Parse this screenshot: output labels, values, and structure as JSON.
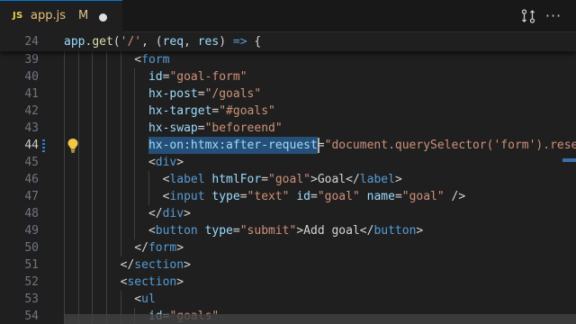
{
  "tab": {
    "icon_text": "JS",
    "file_name": "app.js",
    "modified_flag": "M"
  },
  "actions": {
    "more_label": "···"
  },
  "sticky_line": {
    "number": "24",
    "tokens": [
      {
        "t": "app",
        "c": "var"
      },
      {
        "t": ".",
        "c": "punc"
      },
      {
        "t": "get",
        "c": "fn"
      },
      {
        "t": "(",
        "c": "punc"
      },
      {
        "t": "'/'",
        "c": "str"
      },
      {
        "t": ", (",
        "c": "punc"
      },
      {
        "t": "req",
        "c": "var"
      },
      {
        "t": ", ",
        "c": "punc"
      },
      {
        "t": "res",
        "c": "var"
      },
      {
        "t": ") ",
        "c": "punc"
      },
      {
        "t": "=>",
        "c": "kw"
      },
      {
        "t": " {",
        "c": "punc"
      }
    ]
  },
  "lines": [
    {
      "number": "39",
      "indent": 5,
      "tokens": [
        {
          "t": "<",
          "c": "punc"
        },
        {
          "t": "form",
          "c": "tag"
        }
      ]
    },
    {
      "number": "40",
      "indent": 6,
      "tokens": [
        {
          "t": "id",
          "c": "attr"
        },
        {
          "t": "=",
          "c": "punc"
        },
        {
          "t": "\"goal-form\"",
          "c": "str"
        }
      ]
    },
    {
      "number": "41",
      "indent": 6,
      "tokens": [
        {
          "t": "hx-post",
          "c": "attr"
        },
        {
          "t": "=",
          "c": "punc"
        },
        {
          "t": "\"/goals\"",
          "c": "str"
        }
      ]
    },
    {
      "number": "42",
      "indent": 6,
      "tokens": [
        {
          "t": "hx-target",
          "c": "attr"
        },
        {
          "t": "=",
          "c": "punc"
        },
        {
          "t": "\"#goals\"",
          "c": "str"
        }
      ]
    },
    {
      "number": "43",
      "indent": 6,
      "tokens": [
        {
          "t": "hx-swap",
          "c": "attr"
        },
        {
          "t": "=",
          "c": "punc"
        },
        {
          "t": "\"beforeend\"",
          "c": "str"
        }
      ]
    },
    {
      "number": "44",
      "indent": 6,
      "active": true,
      "selection": [
        0,
        23
      ],
      "tokens": [
        {
          "t": "hx-on:htmx:after-request",
          "c": "attr"
        },
        {
          "t": "=",
          "c": "punc"
        },
        {
          "t": "\"document.querySelector('form').reset()\"",
          "c": "str"
        }
      ]
    },
    {
      "number": "45",
      "indent": 6,
      "tokens": [
        {
          "t": "<",
          "c": "punc"
        },
        {
          "t": "div",
          "c": "tag"
        },
        {
          "t": ">",
          "c": "punc"
        }
      ]
    },
    {
      "number": "46",
      "indent": 7,
      "tokens": [
        {
          "t": "<",
          "c": "punc"
        },
        {
          "t": "label",
          "c": "tag"
        },
        {
          "t": " ",
          "c": "text"
        },
        {
          "t": "htmlFor",
          "c": "attr"
        },
        {
          "t": "=",
          "c": "punc"
        },
        {
          "t": "\"goal\"",
          "c": "str"
        },
        {
          "t": ">",
          "c": "punc"
        },
        {
          "t": "Goal",
          "c": "text"
        },
        {
          "t": "</",
          "c": "punc"
        },
        {
          "t": "label",
          "c": "tag"
        },
        {
          "t": ">",
          "c": "punc"
        }
      ]
    },
    {
      "number": "47",
      "indent": 7,
      "tokens": [
        {
          "t": "<",
          "c": "punc"
        },
        {
          "t": "input",
          "c": "tag"
        },
        {
          "t": " ",
          "c": "text"
        },
        {
          "t": "type",
          "c": "attr"
        },
        {
          "t": "=",
          "c": "punc"
        },
        {
          "t": "\"text\"",
          "c": "str"
        },
        {
          "t": " ",
          "c": "text"
        },
        {
          "t": "id",
          "c": "attr"
        },
        {
          "t": "=",
          "c": "punc"
        },
        {
          "t": "\"goal\"",
          "c": "str"
        },
        {
          "t": " ",
          "c": "text"
        },
        {
          "t": "name",
          "c": "attr"
        },
        {
          "t": "=",
          "c": "punc"
        },
        {
          "t": "\"goal\"",
          "c": "str"
        },
        {
          "t": " />",
          "c": "punc"
        }
      ]
    },
    {
      "number": "48",
      "indent": 6,
      "tokens": [
        {
          "t": "</",
          "c": "punc"
        },
        {
          "t": "div",
          "c": "tag"
        },
        {
          "t": ">",
          "c": "punc"
        }
      ]
    },
    {
      "number": "49",
      "indent": 6,
      "tokens": [
        {
          "t": "<",
          "c": "punc"
        },
        {
          "t": "button",
          "c": "tag"
        },
        {
          "t": " ",
          "c": "text"
        },
        {
          "t": "type",
          "c": "attr"
        },
        {
          "t": "=",
          "c": "punc"
        },
        {
          "t": "\"submit\"",
          "c": "str"
        },
        {
          "t": ">",
          "c": "punc"
        },
        {
          "t": "Add goal",
          "c": "text"
        },
        {
          "t": "</",
          "c": "punc"
        },
        {
          "t": "button",
          "c": "tag"
        },
        {
          "t": ">",
          "c": "punc"
        }
      ]
    },
    {
      "number": "50",
      "indent": 5,
      "tokens": [
        {
          "t": "</",
          "c": "punc"
        },
        {
          "t": "form",
          "c": "tag"
        },
        {
          "t": ">",
          "c": "punc"
        }
      ]
    },
    {
      "number": "51",
      "indent": 4,
      "tokens": [
        {
          "t": "</",
          "c": "punc"
        },
        {
          "t": "section",
          "c": "tag"
        },
        {
          "t": ">",
          "c": "punc"
        }
      ]
    },
    {
      "number": "52",
      "indent": 4,
      "tokens": [
        {
          "t": "<",
          "c": "punc"
        },
        {
          "t": "section",
          "c": "tag"
        },
        {
          "t": ">",
          "c": "punc"
        }
      ]
    },
    {
      "number": "53",
      "indent": 5,
      "tokens": [
        {
          "t": "<",
          "c": "punc"
        },
        {
          "t": "ul",
          "c": "tag"
        }
      ]
    },
    {
      "number": "54",
      "indent": 6,
      "tokens": [
        {
          "t": "id",
          "c": "attr"
        },
        {
          "t": "=",
          "c": "punc"
        },
        {
          "t": "\"goals\"",
          "c": "str"
        }
      ]
    }
  ],
  "colors": {
    "accent": "#0078d4",
    "selection": "#264f78",
    "js_icon": "#e8d44d",
    "modified": "#e2c08d",
    "bulb": "#f2c744"
  },
  "icons": {
    "tab_icon": "javascript-file-icon",
    "modified_dot": "unsaved-dot-icon",
    "compare": "compare-changes-icon",
    "more": "more-actions-icon",
    "lightbulb": "lightbulb-icon"
  }
}
